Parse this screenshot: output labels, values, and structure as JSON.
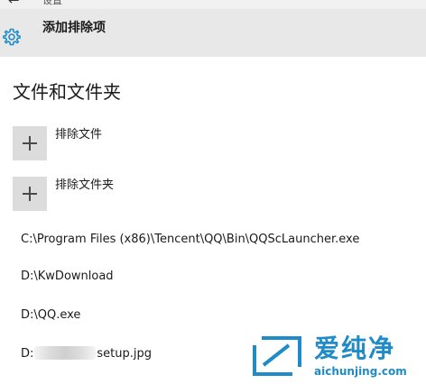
{
  "window": {
    "back_symbol": "←",
    "title": "设置"
  },
  "header": {
    "icon": "gear-icon",
    "title": "添加排除项"
  },
  "section": {
    "title": "文件和文件夹"
  },
  "actions": [
    {
      "icon": "plus-icon",
      "label": "排除文件"
    },
    {
      "icon": "plus-icon",
      "label": "排除文件夹"
    }
  ],
  "exclusions": [
    {
      "path": "C:\\Program Files (x86)\\Tencent\\QQ\\Bin\\QQScLauncher.exe"
    },
    {
      "path": "D:\\KwDownload"
    },
    {
      "path": "D:\\QQ.exe"
    },
    {
      "prefix": "D:",
      "suffix": "setup.jpg"
    }
  ],
  "watermark": {
    "name": "爱纯净",
    "url": "aichunjing.com"
  },
  "colors": {
    "header_bg": "#e8e8e8",
    "tile_bg": "#dcdcdc",
    "accent": "#1f8bc7"
  }
}
